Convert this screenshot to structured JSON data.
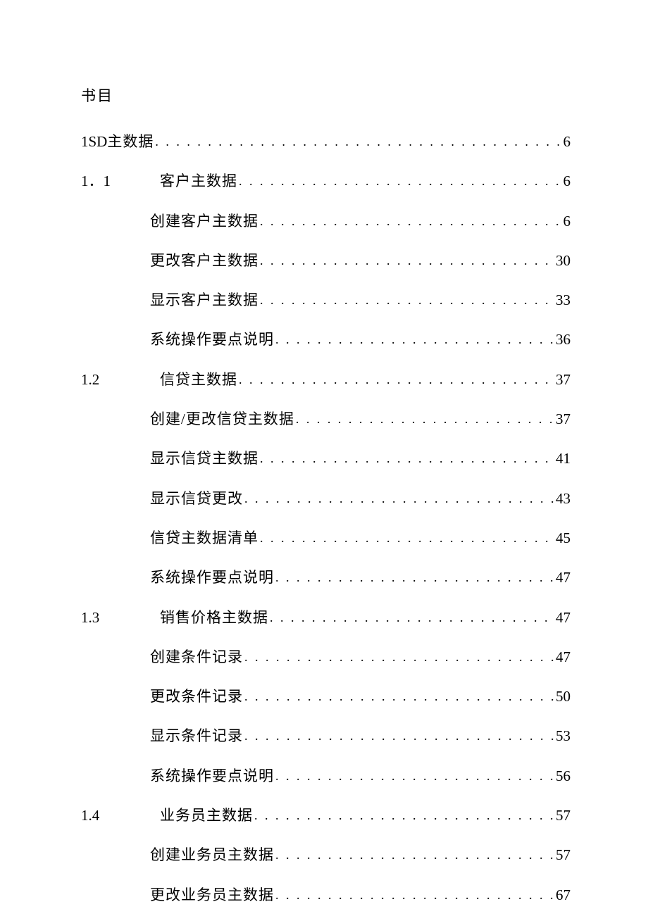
{
  "title": "书目",
  "dots": ". . . . . . . . . . . . . . . . . . . . . . . . . . . . . . . . . . . . . . . . . . . . . . . . . . . . . . . . . . . . . . . . . . . . . . . . . . . . . . . . . . . . . . . . . . . . . . . . . . . . . . . . . . . . . . . . . . . . . . . . .",
  "entries": [
    {
      "indent": 0,
      "num": "1SD",
      "text": "主数据",
      "page": "6"
    },
    {
      "indent": 1,
      "num": "1．1",
      "text": "客户主数据",
      "page": "6"
    },
    {
      "indent": 2,
      "num": "",
      "text": "创建客户主数据",
      "page": "6"
    },
    {
      "indent": 2,
      "num": "",
      "text": "更改客户主数据",
      "page": "30"
    },
    {
      "indent": 2,
      "num": "",
      "text": "显示客户主数据",
      "page": "33"
    },
    {
      "indent": 2,
      "num": "",
      "text": "系统操作要点说明",
      "page": "36"
    },
    {
      "indent": 1,
      "num": "1.2",
      "text": "信贷主数据",
      "page": "37"
    },
    {
      "indent": 2,
      "num": "",
      "text": "创建/更改信贷主数据",
      "page": "37"
    },
    {
      "indent": 2,
      "num": "",
      "text": "显示信贷主数据",
      "page": "41"
    },
    {
      "indent": 2,
      "num": "",
      "text": "显示信贷更改",
      "page": "43"
    },
    {
      "indent": 2,
      "num": "",
      "text": "信贷主数据清单",
      "page": "45"
    },
    {
      "indent": 2,
      "num": "",
      "text": "系统操作要点说明",
      "page": "47"
    },
    {
      "indent": 1,
      "num": "1.3",
      "text": "销售价格主数据",
      "page": "47"
    },
    {
      "indent": 2,
      "num": "",
      "text": "创建条件记录",
      "page": "47"
    },
    {
      "indent": 2,
      "num": "",
      "text": "更改条件记录",
      "page": "50"
    },
    {
      "indent": 2,
      "num": "",
      "text": "显示条件记录",
      "page": "53"
    },
    {
      "indent": 2,
      "num": "",
      "text": "系统操作要点说明",
      "page": "56"
    },
    {
      "indent": 1,
      "num": "1.4",
      "text": "业务员主数据",
      "page": "57"
    },
    {
      "indent": 2,
      "num": "",
      "text": "创建业务员主数据",
      "page": "57"
    },
    {
      "indent": 2,
      "num": "",
      "text": "更改业务员主数据",
      "page": "67"
    }
  ]
}
